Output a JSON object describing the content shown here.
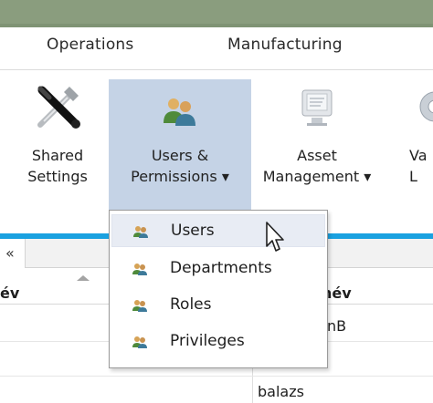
{
  "ribbon_tabs": [
    {
      "label": "Operations"
    },
    {
      "label": "Manufacturing"
    }
  ],
  "ribbon_buttons": {
    "shared_settings": {
      "line1": "Shared",
      "line2": "Settings",
      "icon": "tools-icon"
    },
    "users_permissions": {
      "line1": "Users &",
      "line2": "Permissions ▾",
      "icon": "users-icon"
    },
    "asset_management": {
      "line1": "Asset",
      "line2": "Management ▾",
      "icon": "asset-icon"
    },
    "va_partial": {
      "line1": "Va",
      "line2": "L",
      "icon": "gear-icon"
    }
  },
  "subbar": {
    "chevron": "«"
  },
  "grid": {
    "col1_header": "év",
    "col2_header": "név",
    "rows": [
      {
        "col2": "nB"
      },
      {
        "col2": "balazs"
      }
    ]
  },
  "dropdown": {
    "items": [
      {
        "label": "Users",
        "icon": "user-group-icon",
        "hovered": true
      },
      {
        "label": "Departments",
        "icon": "user-group-icon",
        "hovered": false
      },
      {
        "label": "Roles",
        "icon": "user-group-icon",
        "hovered": false
      },
      {
        "label": "Privileges",
        "icon": "user-group-icon",
        "hovered": false
      }
    ]
  },
  "colors": {
    "title_strip": "#8a9d7e",
    "selected_button": "#c5d3e6",
    "accent_band": "#1aa1e0",
    "menu_hover": "#e8ecf4"
  }
}
